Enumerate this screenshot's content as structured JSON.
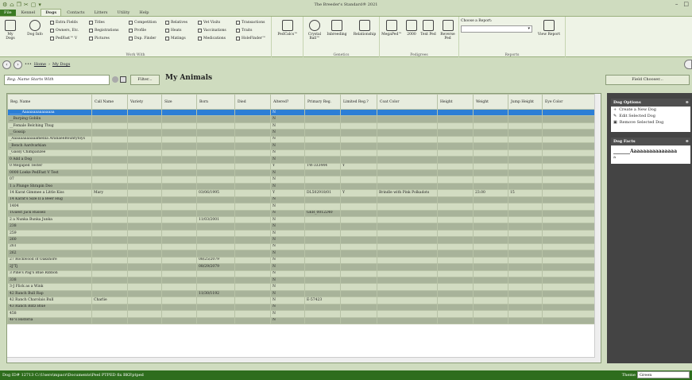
{
  "titlebar": {
    "title": "The Breeder's Standard® 2021",
    "minimize": "–",
    "maximize": "□"
  },
  "quick_access": [
    "⚙",
    "⌂",
    "❐",
    "✂",
    "▢",
    "▾"
  ],
  "tabs": [
    "File",
    "Kennel",
    "Dogs",
    "Contacts",
    "Litters",
    "Utility",
    "Help"
  ],
  "ribbon": {
    "my_dogs": "My Dogs",
    "dog_info": "Dog Info",
    "extra_fields": "Extra Fields",
    "owners": "Owners, Etc.",
    "pedfast": "PedFast™ V",
    "titles": "Titles",
    "registrations": "Registrations",
    "pictures": "Pictures",
    "competition": "Competition",
    "profile": "Profile",
    "dup_finder": "Dup. Finder",
    "relatives": "Relatives",
    "heats": "Heats",
    "matings": "Matings",
    "vet_visits": "Vet Visits",
    "vaccinations": "Vaccinations",
    "medications": "Medications",
    "transactions": "Transactions",
    "traits": "Traits",
    "holefinder": "HoleFinder™",
    "work_with": "Work With",
    "pedcalcs": "PedCalcs™",
    "crystal_ball": "Crystal Ball™",
    "inbreeding": "Inbreeding",
    "relationship": "Relationship",
    "genetics": "Genetics",
    "megaped": "MegaPed™",
    "ped_2000": "2000",
    "text_ped": "Text Ped",
    "reverse_ped": "Reverse Ped",
    "pedigrees": "Pedigrees",
    "choose_report": "Choose a Report:",
    "view_report": "View Report",
    "reports": "Reports"
  },
  "nav": {
    "home": "Home",
    "my_dogs": "My Dogs",
    "dots": "•••"
  },
  "filter": {
    "placeholder": "Reg. Name Starts With",
    "button": "Filter...",
    "title": "My Animals",
    "field_chooser": "Field Chooser..."
  },
  "columns": [
    "Reg. Name",
    "Call Name",
    "Variety",
    "Size",
    "Born",
    "Died",
    "Altered?",
    "Primary Reg.",
    "Limited Reg.?",
    "Coat Color",
    "Height",
    "Weight",
    "Jump Height",
    "Eye Color"
  ],
  "rows": [
    [
      "_______Aaaaaaaaaaaaaaa",
      "",
      "",
      "",
      "",
      "",
      "N",
      "",
      "",
      "",
      "",
      "",
      "",
      ""
    ],
    [
      "__Burping Goblin",
      "",
      "",
      "",
      "",
      "",
      "N",
      "",
      "",
      "",
      "",
      "",
      "",
      ""
    ],
    [
      "__Female Belching Thug",
      "",
      "",
      "",
      "",
      "",
      "N",
      "",
      "",
      "",
      "",
      "",
      "",
      ""
    ],
    [
      "__Gossip",
      "",
      "",
      "",
      "",
      "",
      "N",
      "",
      "",
      "",
      "",
      "",
      "",
      ""
    ],
    [
      "_Aaaaaaaaaaaamellia AranaeéBountytoys",
      "",
      "",
      "",
      "",
      "",
      "N",
      "",
      "",
      "",
      "",
      "",
      "",
      ""
    ],
    [
      "_Bench Aardvarkian",
      "",
      "",
      "",
      "",
      "",
      "N",
      "",
      "",
      "",
      "",
      "",
      "",
      ""
    ],
    [
      "_Gassy Chimpanzee",
      "",
      "",
      "",
      "",
      "",
      "N",
      "",
      "",
      "",
      "",
      "",
      "",
      ""
    ],
    [
      "0 Add a Dog",
      "",
      "",
      "",
      "",
      "",
      "N",
      "",
      "",
      "",
      "",
      "",
      "",
      ""
    ],
    [
      "0 Megaped Tester",
      "",
      "",
      "",
      "",
      "",
      "Y",
      "TW-333444",
      "Y",
      "",
      "",
      "",
      "",
      ""
    ],
    [
      "0000 Loeke PedFast V Test",
      "",
      "",
      "",
      "",
      "",
      "N",
      "",
      "",
      "",
      "",
      "",
      "",
      ""
    ],
    [
      "07",
      "",
      "",
      "",
      "",
      "",
      "N",
      "",
      "",
      "",
      "",
      "",
      "",
      ""
    ],
    [
      "1 a Plunge Shrapin Doo",
      "",
      "",
      "",
      "",
      "",
      "N",
      "",
      "",
      "",
      "",
      "",
      "",
      ""
    ],
    [
      "14 Karat Gimmee a Little Kiss",
      "Mary",
      "",
      "",
      "03/06/1995",
      "",
      "Y",
      "DL502918/01",
      "Y",
      "Brindle with Pink Polkadots",
      "",
      "23.00",
      "15",
      ""
    ],
    [
      "14 Karat's Size II a Beer Hug",
      "",
      "",
      "",
      "",
      "",
      "N",
      "",
      "",
      "",
      "",
      "",
      "",
      ""
    ],
    [
      "1404",
      "",
      "",
      "",
      "",
      "",
      "N",
      "",
      "",
      "",
      "",
      "",
      "",
      ""
    ],
    [
      "1Guest Jack Russell",
      "",
      "",
      "",
      "",
      "",
      "N",
      "GER_0012240",
      "",
      "",
      "",
      "",
      "",
      ""
    ],
    [
      "2 a Nunka Bunka Junka",
      "",
      "",
      "",
      "11/03/2001",
      "",
      "N",
      "",
      "",
      "",
      "",
      "",
      "",
      ""
    ],
    [
      "238",
      "",
      "",
      "",
      "",
      "",
      "N",
      "",
      "",
      "",
      "",
      "",
      "",
      ""
    ],
    [
      "259",
      "",
      "",
      "",
      "",
      "",
      "N",
      "",
      "",
      "",
      "",
      "",
      "",
      ""
    ],
    [
      "260",
      "",
      "",
      "",
      "",
      "",
      "N",
      "",
      "",
      "",
      "",
      "",
      "",
      ""
    ],
    [
      "261",
      "",
      "",
      "",
      "",
      "",
      "N",
      "",
      "",
      "",
      "",
      "",
      "",
      ""
    ],
    [
      "262",
      "",
      "",
      "",
      "",
      "",
      "N",
      "",
      "",
      "",
      "",
      "",
      "",
      ""
    ],
    [
      "27 Rockwood of Oakshore",
      "",
      "",
      "",
      "08/25/2079",
      "",
      "N",
      "",
      "",
      "",
      "",
      "",
      "",
      ""
    ],
    [
      "2J'Tj",
      "",
      "",
      "",
      "08/29/2079",
      "",
      "N",
      "",
      "",
      "",
      "",
      "",
      "",
      ""
    ],
    [
      "3 Pine's Pag's Blue Ribbon",
      "",
      "",
      "",
      "",
      "",
      "N",
      "",
      "",
      "",
      "",
      "",
      "",
      ""
    ],
    [
      "338",
      "",
      "",
      "",
      "",
      "",
      "N",
      "",
      "",
      "",
      "",
      "",
      "",
      ""
    ],
    [
      "3-J Flick as a Wink",
      "",
      "",
      "",
      "",
      "",
      "N",
      "",
      "",
      "",
      "",
      "",
      "",
      ""
    ],
    [
      "42 Ranch Bull Rap",
      "",
      "",
      "",
      "11/30/1192",
      "",
      "N",
      "",
      "",
      "",
      "",
      "",
      "",
      ""
    ],
    [
      "42 Ranch Charolais Bull",
      "Charlie",
      "",
      "",
      "",
      "",
      "N",
      "E-57423",
      "",
      "",
      "",
      "",
      "",
      ""
    ],
    [
      "43 Ranch Blitz Blue",
      "",
      "",
      "",
      "",
      "",
      "N",
      "",
      "",
      "",
      "",
      "",
      "",
      ""
    ],
    [
      "458",
      "",
      "",
      "",
      "",
      "",
      "N",
      "",
      "",
      "",
      "",
      "",
      "",
      ""
    ],
    [
      "4F's Historia",
      "",
      "",
      "",
      "",
      "",
      "N",
      "",
      "",
      "",
      "",
      "",
      "",
      ""
    ]
  ],
  "dog_options": {
    "title": "Dog Options",
    "items": [
      "Create a New Dog",
      "Edit Selected Dog",
      "Remove Selected Dog"
    ]
  },
  "dog_facts": {
    "title": "Dog Facts",
    "name": "_______Aaaaaaaaaaaaaaa",
    "extra": "a"
  },
  "status": {
    "text": "Dog ID# 12713   C:\\Users\\mpacr\\Documents\\Peel PTPED fix BKP.ptped",
    "theme_label": "Theme",
    "theme_value": "Green"
  },
  "colors": {
    "accent": "#2e6d1d",
    "selected_row": "#2c7ed6"
  }
}
